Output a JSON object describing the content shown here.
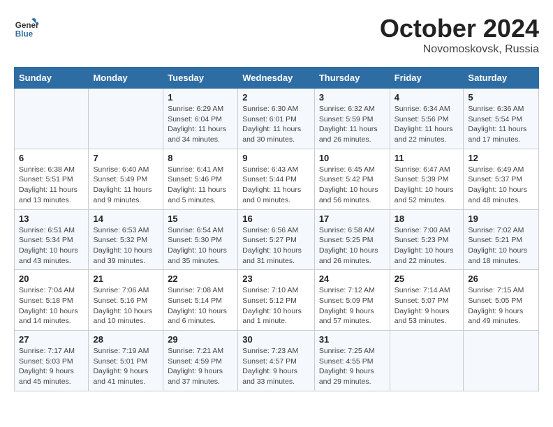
{
  "header": {
    "logo_line1": "General",
    "logo_line2": "Blue",
    "month": "October 2024",
    "location": "Novomoskovsk, Russia"
  },
  "weekdays": [
    "Sunday",
    "Monday",
    "Tuesday",
    "Wednesday",
    "Thursday",
    "Friday",
    "Saturday"
  ],
  "weeks": [
    [
      {
        "day": "",
        "info": ""
      },
      {
        "day": "",
        "info": ""
      },
      {
        "day": "1",
        "info": "Sunrise: 6:29 AM\nSunset: 6:04 PM\nDaylight: 11 hours and 34 minutes."
      },
      {
        "day": "2",
        "info": "Sunrise: 6:30 AM\nSunset: 6:01 PM\nDaylight: 11 hours and 30 minutes."
      },
      {
        "day": "3",
        "info": "Sunrise: 6:32 AM\nSunset: 5:59 PM\nDaylight: 11 hours and 26 minutes."
      },
      {
        "day": "4",
        "info": "Sunrise: 6:34 AM\nSunset: 5:56 PM\nDaylight: 11 hours and 22 minutes."
      },
      {
        "day": "5",
        "info": "Sunrise: 6:36 AM\nSunset: 5:54 PM\nDaylight: 11 hours and 17 minutes."
      }
    ],
    [
      {
        "day": "6",
        "info": "Sunrise: 6:38 AM\nSunset: 5:51 PM\nDaylight: 11 hours and 13 minutes."
      },
      {
        "day": "7",
        "info": "Sunrise: 6:40 AM\nSunset: 5:49 PM\nDaylight: 11 hours and 9 minutes."
      },
      {
        "day": "8",
        "info": "Sunrise: 6:41 AM\nSunset: 5:46 PM\nDaylight: 11 hours and 5 minutes."
      },
      {
        "day": "9",
        "info": "Sunrise: 6:43 AM\nSunset: 5:44 PM\nDaylight: 11 hours and 0 minutes."
      },
      {
        "day": "10",
        "info": "Sunrise: 6:45 AM\nSunset: 5:42 PM\nDaylight: 10 hours and 56 minutes."
      },
      {
        "day": "11",
        "info": "Sunrise: 6:47 AM\nSunset: 5:39 PM\nDaylight: 10 hours and 52 minutes."
      },
      {
        "day": "12",
        "info": "Sunrise: 6:49 AM\nSunset: 5:37 PM\nDaylight: 10 hours and 48 minutes."
      }
    ],
    [
      {
        "day": "13",
        "info": "Sunrise: 6:51 AM\nSunset: 5:34 PM\nDaylight: 10 hours and 43 minutes."
      },
      {
        "day": "14",
        "info": "Sunrise: 6:53 AM\nSunset: 5:32 PM\nDaylight: 10 hours and 39 minutes."
      },
      {
        "day": "15",
        "info": "Sunrise: 6:54 AM\nSunset: 5:30 PM\nDaylight: 10 hours and 35 minutes."
      },
      {
        "day": "16",
        "info": "Sunrise: 6:56 AM\nSunset: 5:27 PM\nDaylight: 10 hours and 31 minutes."
      },
      {
        "day": "17",
        "info": "Sunrise: 6:58 AM\nSunset: 5:25 PM\nDaylight: 10 hours and 26 minutes."
      },
      {
        "day": "18",
        "info": "Sunrise: 7:00 AM\nSunset: 5:23 PM\nDaylight: 10 hours and 22 minutes."
      },
      {
        "day": "19",
        "info": "Sunrise: 7:02 AM\nSunset: 5:21 PM\nDaylight: 10 hours and 18 minutes."
      }
    ],
    [
      {
        "day": "20",
        "info": "Sunrise: 7:04 AM\nSunset: 5:18 PM\nDaylight: 10 hours and 14 minutes."
      },
      {
        "day": "21",
        "info": "Sunrise: 7:06 AM\nSunset: 5:16 PM\nDaylight: 10 hours and 10 minutes."
      },
      {
        "day": "22",
        "info": "Sunrise: 7:08 AM\nSunset: 5:14 PM\nDaylight: 10 hours and 6 minutes."
      },
      {
        "day": "23",
        "info": "Sunrise: 7:10 AM\nSunset: 5:12 PM\nDaylight: 10 hours and 1 minute."
      },
      {
        "day": "24",
        "info": "Sunrise: 7:12 AM\nSunset: 5:09 PM\nDaylight: 9 hours and 57 minutes."
      },
      {
        "day": "25",
        "info": "Sunrise: 7:14 AM\nSunset: 5:07 PM\nDaylight: 9 hours and 53 minutes."
      },
      {
        "day": "26",
        "info": "Sunrise: 7:15 AM\nSunset: 5:05 PM\nDaylight: 9 hours and 49 minutes."
      }
    ],
    [
      {
        "day": "27",
        "info": "Sunrise: 7:17 AM\nSunset: 5:03 PM\nDaylight: 9 hours and 45 minutes."
      },
      {
        "day": "28",
        "info": "Sunrise: 7:19 AM\nSunset: 5:01 PM\nDaylight: 9 hours and 41 minutes."
      },
      {
        "day": "29",
        "info": "Sunrise: 7:21 AM\nSunset: 4:59 PM\nDaylight: 9 hours and 37 minutes."
      },
      {
        "day": "30",
        "info": "Sunrise: 7:23 AM\nSunset: 4:57 PM\nDaylight: 9 hours and 33 minutes."
      },
      {
        "day": "31",
        "info": "Sunrise: 7:25 AM\nSunset: 4:55 PM\nDaylight: 9 hours and 29 minutes."
      },
      {
        "day": "",
        "info": ""
      },
      {
        "day": "",
        "info": ""
      }
    ]
  ]
}
